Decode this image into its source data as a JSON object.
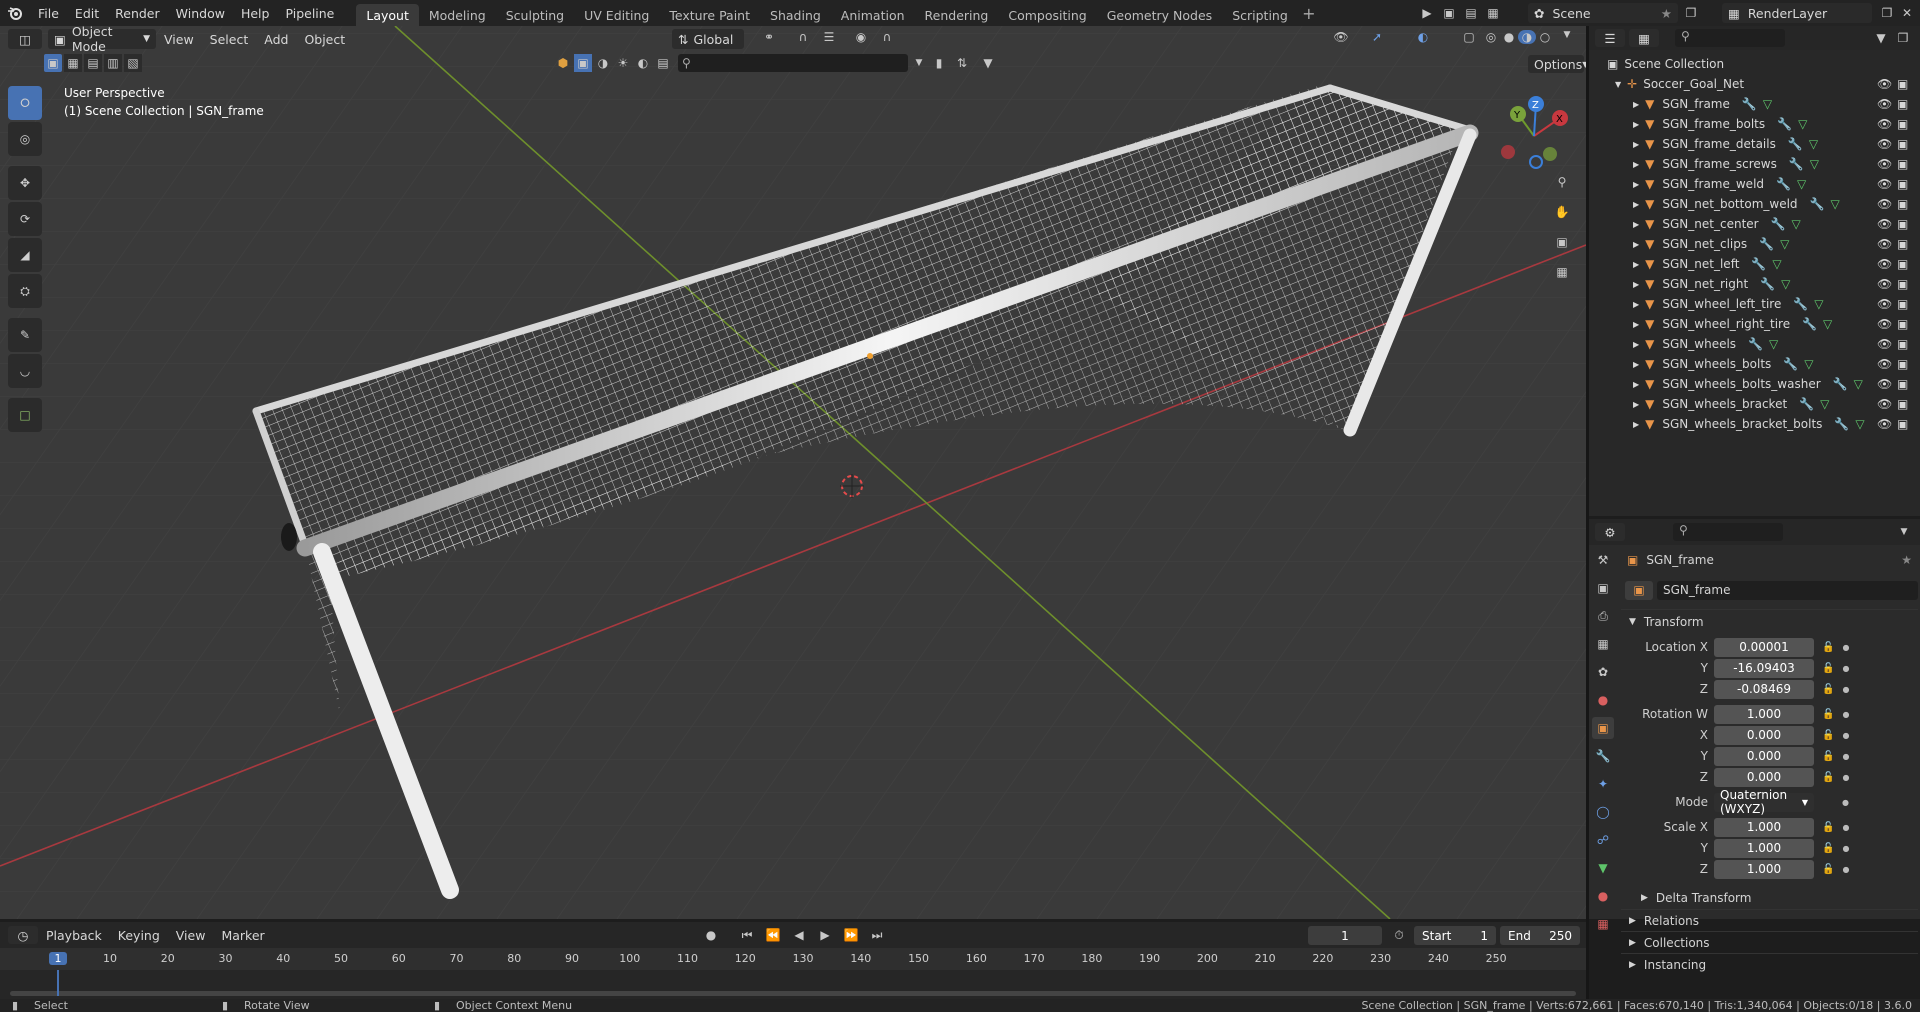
{
  "menu": {
    "file": "File",
    "edit": "Edit",
    "render": "Render",
    "window": "Window",
    "help": "Help",
    "pipeline": "Pipeline"
  },
  "workspaces": [
    "Layout",
    "Modeling",
    "Sculpting",
    "UV Editing",
    "Texture Paint",
    "Shading",
    "Animation",
    "Rendering",
    "Compositing",
    "Geometry Nodes",
    "Scripting"
  ],
  "active_workspace": "Layout",
  "scene_name": "Scene",
  "render_layer": "RenderLayer",
  "viewport": {
    "mode": "Object Mode",
    "menus": {
      "view": "View",
      "select": "Select",
      "add": "Add",
      "object": "Object"
    },
    "orientation": "Global",
    "options": "Options",
    "overlay_line1": "User Perspective",
    "overlay_line2": "(1) Scene Collection | SGN_frame",
    "gizmo": {
      "x": "X",
      "y": "Y",
      "z": "Z"
    }
  },
  "outliner": {
    "root": "Scene Collection",
    "collection": "Soccer_Goal_Net",
    "objects": [
      "SGN_frame",
      "SGN_frame_bolts",
      "SGN_frame_details",
      "SGN_frame_screws",
      "SGN_frame_weld",
      "SGN_net_bottom_weld",
      "SGN_net_center",
      "SGN_net_clips",
      "SGN_net_left",
      "SGN_net_right",
      "SGN_wheel_left_tire",
      "SGN_wheel_right_tire",
      "SGN_wheels",
      "SGN_wheels_bolts",
      "SGN_wheels_bolts_washer",
      "SGN_wheels_bracket",
      "SGN_wheels_bracket_bolts"
    ]
  },
  "properties": {
    "object_name": "SGN_frame",
    "data_name": "SGN_frame",
    "transform_label": "Transform",
    "location_label": "Location X",
    "location": {
      "x": "0.00001",
      "y": "-16.09403",
      "z": "-0.08469"
    },
    "rotation_label": "Rotation W",
    "rotation": {
      "w": "1.000",
      "x": "0.000",
      "y": "0.000",
      "z": "0.000"
    },
    "mode_label": "Mode",
    "mode_value": "Quaternion (WXYZ)",
    "scale_label": "Scale X",
    "scale": {
      "x": "1.000",
      "y": "1.000",
      "z": "1.000"
    },
    "axis": {
      "x": "X",
      "y": "Y",
      "z": "Z"
    },
    "delta": "Delta Transform",
    "relations": "Relations",
    "collections": "Collections",
    "instancing": "Instancing"
  },
  "timeline": {
    "menus": {
      "playback": "Playback",
      "keying": "Keying",
      "view": "View",
      "marker": "Marker"
    },
    "current_frame": "1",
    "start_label": "Start",
    "start": "1",
    "end_label": "End",
    "end": "250",
    "ticks": [
      "1",
      "10",
      "20",
      "30",
      "40",
      "50",
      "60",
      "70",
      "80",
      "90",
      "100",
      "110",
      "120",
      "130",
      "140",
      "150",
      "160",
      "170",
      "180",
      "190",
      "200",
      "210",
      "220",
      "230",
      "240",
      "250"
    ]
  },
  "status": {
    "select": "Select",
    "rotate": "Rotate View",
    "context": "Object Context Menu",
    "info": "Scene Collection | SGN_frame | Verts:672,661 | Faces:670,140 | Tris:1,340,064 | Objects:0/18 | 3.6.0"
  },
  "colors": {
    "accent": "#4772b3",
    "header": "#232323",
    "viewport": "#3b3b3b",
    "object_icon": "#e8954a",
    "axis_x": "#c8383f",
    "axis_y": "#7aa23b",
    "axis_z": "#3b7fd9"
  }
}
